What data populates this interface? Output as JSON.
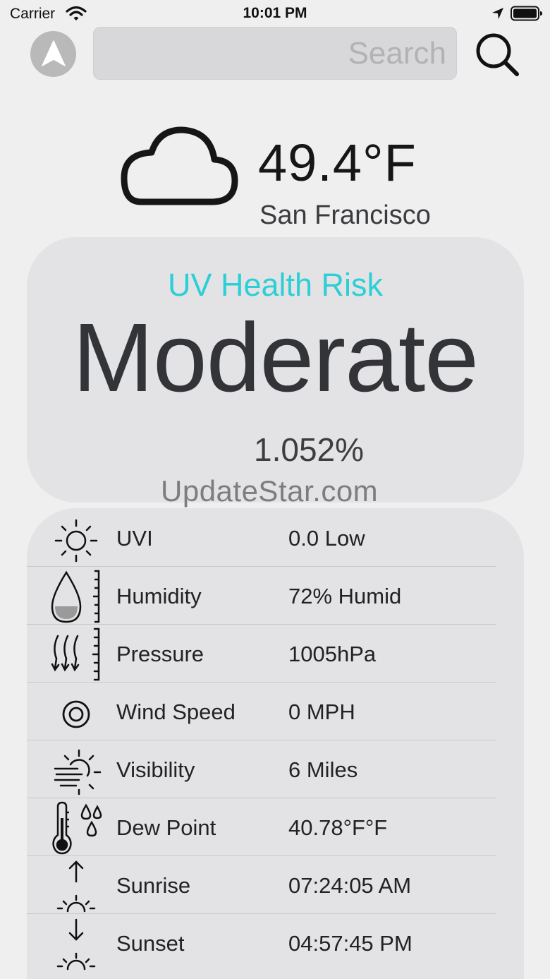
{
  "status_bar": {
    "carrier": "Carrier",
    "time": "10:01 PM"
  },
  "search": {
    "placeholder": "Search",
    "value": ""
  },
  "current": {
    "temperature": "49.4°F",
    "city": "San Francisco",
    "condition_icon": "cloud-icon"
  },
  "uv": {
    "title": "UV Health Risk",
    "level": "Moderate",
    "percent": "1.052%",
    "title_color": "#2ccfd6"
  },
  "watermark": "UpdateStar.com",
  "details": [
    {
      "icon": "sun-icon",
      "label": "UVI",
      "value": "0.0 Low"
    },
    {
      "icon": "humidity-drop-icon",
      "label": "Humidity",
      "value": "72% Humid"
    },
    {
      "icon": "pressure-icon",
      "label": "Pressure",
      "value": "1005hPa"
    },
    {
      "icon": "wind-target-icon",
      "label": "Wind Speed",
      "value": "0 MPH"
    },
    {
      "icon": "visibility-haze-icon",
      "label": "Visibility",
      "value": "6 Miles"
    },
    {
      "icon": "thermometer-drops-icon",
      "label": "Dew Point",
      "value": "40.78°F°F"
    },
    {
      "icon": "sunrise-icon",
      "label": "Sunrise",
      "value": "07:24:05 AM"
    },
    {
      "icon": "sunset-icon",
      "label": "Sunset",
      "value": "04:57:45 PM"
    }
  ]
}
